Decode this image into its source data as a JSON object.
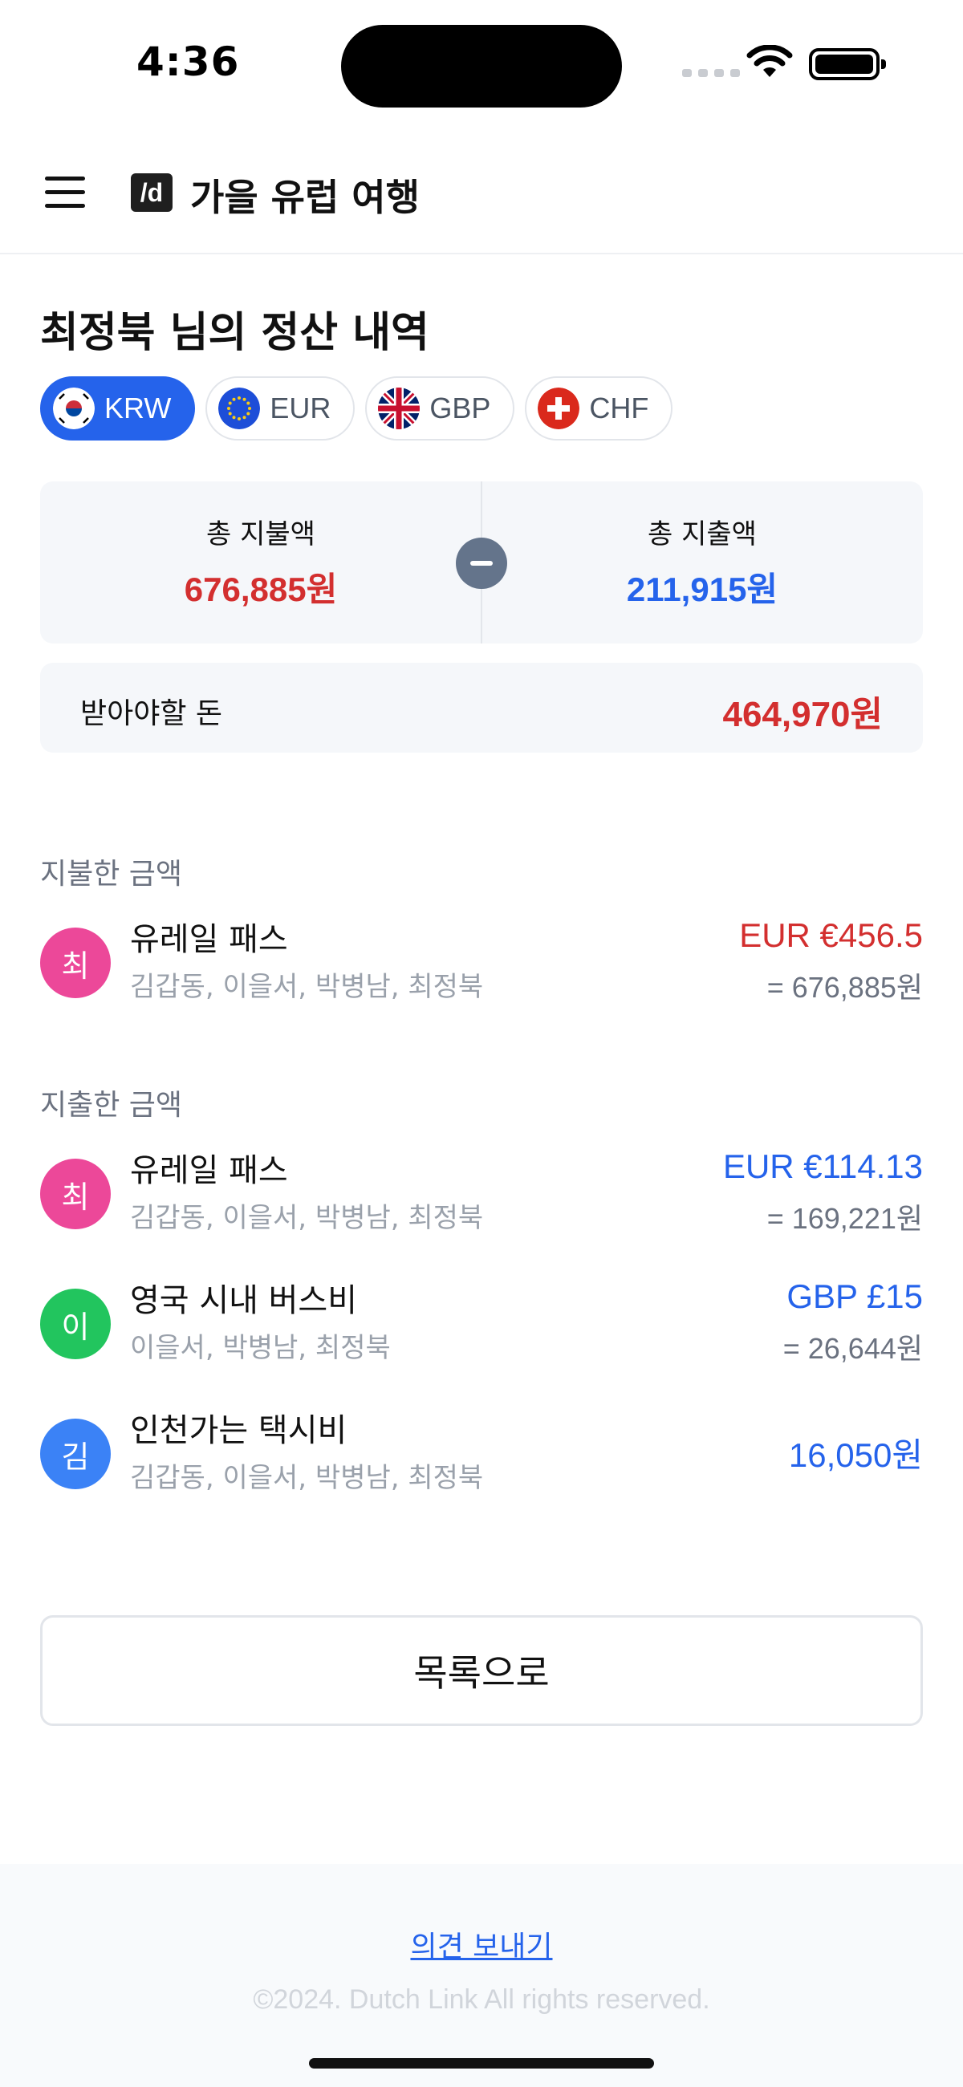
{
  "status": {
    "time": "4:36"
  },
  "header": {
    "logo": "/d",
    "title": "가을 유럽 여행"
  },
  "page": {
    "title": "최정북 님의 정산 내역"
  },
  "currencies": [
    {
      "code": "KRW",
      "active": true
    },
    {
      "code": "EUR",
      "active": false
    },
    {
      "code": "GBP",
      "active": false
    },
    {
      "code": "CHF",
      "active": false
    }
  ],
  "summary": {
    "paid_label": "총 지불액",
    "paid_value": "676,885원",
    "spent_label": "총 지출액",
    "spent_value": "211,915원",
    "receive_label": "받아야할 돈",
    "receive_value": "464,970원"
  },
  "paid_section": {
    "label": "지불한 금액",
    "items": [
      {
        "avatar": "최",
        "avatar_color": "#ec4899",
        "title": "유레일 패스",
        "members": "김갑동, 이을서, 박병남, 최정북",
        "amount": "EUR €456.5",
        "converted": "= 676,885원"
      }
    ]
  },
  "spent_section": {
    "label": "지출한 금액",
    "items": [
      {
        "avatar": "최",
        "avatar_color": "#ec4899",
        "title": "유레일 패스",
        "members": "김갑동, 이을서, 박병남, 최정북",
        "amount": "EUR €114.13",
        "converted": "= 169,221원"
      },
      {
        "avatar": "이",
        "avatar_color": "#22c55e",
        "title": "영국 시내 버스비",
        "members": "이을서, 박병남, 최정북",
        "amount": "GBP £15",
        "converted": "= 26,644원"
      },
      {
        "avatar": "김",
        "avatar_color": "#3b82f6",
        "title": "인천가는 택시비",
        "members": "김갑동, 이을서, 박병남, 최정북",
        "amount": "16,050원",
        "converted": ""
      }
    ]
  },
  "actions": {
    "back_to_list": "목록으로"
  },
  "footer": {
    "feedback": "의견 보내기",
    "copyright": "©2024. Dutch Link All rights reserved."
  },
  "colors": {
    "accent": "#2563eb",
    "negative": "#d32f2f"
  }
}
